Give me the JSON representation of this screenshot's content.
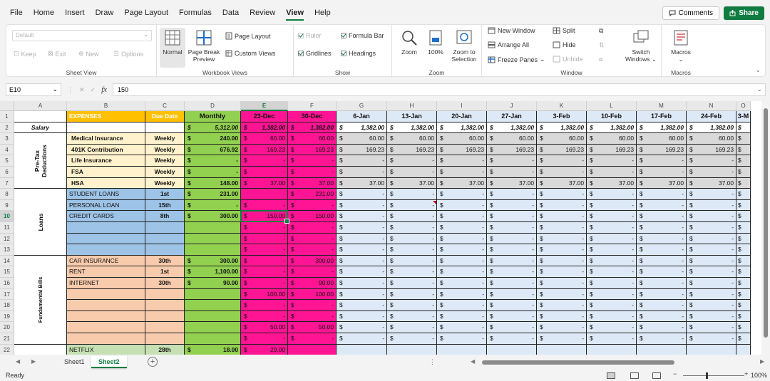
{
  "menu": {
    "items": [
      "File",
      "Home",
      "Insert",
      "Draw",
      "Page Layout",
      "Formulas",
      "Data",
      "Review",
      "View",
      "Help"
    ],
    "active": "View",
    "comments": "Comments",
    "share": "Share"
  },
  "ribbon": {
    "sheet_view": {
      "dropdown": "Default",
      "keep": "Keep",
      "exit": "Exit",
      "new": "New",
      "options": "Options",
      "label": "Sheet View"
    },
    "workbook_views": {
      "normal": "Normal",
      "page_break_1": "Page Break",
      "page_break_2": "Preview",
      "page_layout": "Page Layout",
      "custom_views": "Custom Views",
      "label": "Workbook Views"
    },
    "show": {
      "ruler": "Ruler",
      "formula_bar": "Formula Bar",
      "gridlines": "Gridlines",
      "headings": "Headings",
      "label": "Show"
    },
    "zoom": {
      "zoom": "Zoom",
      "hundred": "100%",
      "zoom_sel_1": "Zoom to",
      "zoom_sel_2": "Selection",
      "label": "Zoom"
    },
    "window": {
      "new_window": "New Window",
      "arrange_all": "Arrange All",
      "freeze_panes": "Freeze Panes",
      "split": "Split",
      "hide": "Hide",
      "unhide": "Unhide",
      "switch_1": "Switch",
      "switch_2": "Windows",
      "label": "Window"
    },
    "macros": {
      "macros": "Macros",
      "label": "Macros"
    }
  },
  "formula_bar": {
    "name_box": "E10",
    "fx": "fx",
    "value": "150"
  },
  "columns": [
    "A",
    "B",
    "C",
    "D",
    "E",
    "F",
    "G",
    "H",
    "I",
    "J",
    "K",
    "L",
    "M",
    "N",
    "O"
  ],
  "rows": [
    "1",
    "2",
    "3",
    "4",
    "5",
    "6",
    "7",
    "8",
    "9",
    "10",
    "11",
    "12",
    "13",
    "14",
    "15",
    "16",
    "17",
    "18",
    "19",
    "20",
    "21",
    "22"
  ],
  "group_labels": {
    "salary": "Salary",
    "pretax_1": "Pre-Tax",
    "pretax_2": "Deductions",
    "loans": "Loans",
    "fundamental": "Fundamental Bills"
  },
  "headers": {
    "expenses": "EXPENSES",
    "due_date": "Due Date",
    "monthly": "Monthly",
    "dates": [
      "23-Dec",
      "30-Dec",
      "6-Jan",
      "13-Jan",
      "20-Jan",
      "27-Jan",
      "3-Feb",
      "10-Feb",
      "17-Feb",
      "24-Feb",
      "3-M"
    ]
  },
  "dash": "-",
  "dollar": "$",
  "expense_rows": [
    {
      "name": "",
      "due": "",
      "monthly": "5,312.00",
      "weekly": [
        "1,382.00",
        "1,382.00",
        "1,382.00",
        "1,382.00",
        "1,382.00",
        "1,382.00",
        "1,382.00",
        "1,382.00",
        "1,382.00",
        "1,382.00"
      ]
    },
    {
      "name": "Medical Insurance",
      "due": "Weekly",
      "monthly": "240.00",
      "weekly": [
        "60.00",
        "60.00",
        "60.00",
        "60.00",
        "60.00",
        "60.00",
        "60.00",
        "60.00",
        "60.00",
        "60.00"
      ]
    },
    {
      "name": "401K Contribution",
      "due": "Weekly",
      "monthly": "676.92",
      "weekly": [
        "169.23",
        "169.23",
        "169.23",
        "169.23",
        "169.23",
        "169.23",
        "169.23",
        "169.23",
        "169.23",
        "169.23"
      ]
    },
    {
      "name": "Life Insurance",
      "due": "Weekly",
      "monthly": "-",
      "weekly": [
        "-",
        "-",
        "-",
        "-",
        "-",
        "-",
        "-",
        "-",
        "-",
        "-"
      ]
    },
    {
      "name": "FSA",
      "due": "Weekly",
      "monthly": "-",
      "weekly": [
        "-",
        "-",
        "-",
        "-",
        "-",
        "-",
        "-",
        "-",
        "-",
        "-"
      ]
    },
    {
      "name": "HSA",
      "due": "Weekly",
      "monthly": "148.00",
      "weekly": [
        "37.00",
        "37.00",
        "37.00",
        "37.00",
        "37.00",
        "37.00",
        "37.00",
        "37.00",
        "37.00",
        "37.00"
      ]
    },
    {
      "name": "STUDENT LOANS",
      "due": "1st",
      "monthly": "231.00",
      "weekly": [
        "",
        "231.00",
        "-",
        "-",
        "-",
        "-",
        "-",
        "-",
        "-",
        "-"
      ]
    },
    {
      "name": "PERSONAL LOAN",
      "due": "15th",
      "monthly": "-",
      "weekly": [
        "-",
        "-",
        "-",
        "-",
        "-",
        "-",
        "-",
        "-",
        "-",
        "-"
      ]
    },
    {
      "name": "CREDIT CARDS",
      "due": "8th",
      "monthly": "300.00",
      "weekly": [
        "150.00",
        "150.00",
        "-",
        "-",
        "-",
        "-",
        "-",
        "-",
        "-",
        "-"
      ]
    },
    {
      "name": "",
      "due": "",
      "monthly": "",
      "weekly": [
        "-",
        "-",
        "-",
        "-",
        "-",
        "-",
        "-",
        "-",
        "-",
        "-"
      ]
    },
    {
      "name": "",
      "due": "",
      "monthly": "",
      "weekly": [
        "-",
        "-",
        "-",
        "-",
        "-",
        "-",
        "-",
        "-",
        "-",
        "-"
      ]
    },
    {
      "name": "",
      "due": "",
      "monthly": "",
      "weekly": [
        "-",
        "-",
        "-",
        "-",
        "-",
        "-",
        "-",
        "-",
        "-",
        "-"
      ]
    },
    {
      "name": "CAR INSURANCE",
      "due": "30th",
      "monthly": "300.00",
      "weekly": [
        "-",
        "300.00",
        "-",
        "-",
        "-",
        "-",
        "-",
        "-",
        "-",
        "-"
      ]
    },
    {
      "name": "RENT",
      "due": "1st",
      "monthly": "1,100.00",
      "weekly": [
        "-",
        "-",
        "-",
        "-",
        "-",
        "-",
        "-",
        "-",
        "-",
        "-"
      ]
    },
    {
      "name": "INTERNET",
      "due": "30th",
      "monthly": "90.00",
      "weekly": [
        "-",
        "90.00",
        "-",
        "-",
        "-",
        "-",
        "-",
        "-",
        "-",
        "-"
      ]
    },
    {
      "name": "",
      "due": "",
      "monthly": "",
      "weekly": [
        "100.00",
        "100.00",
        "-",
        "-",
        "-",
        "-",
        "-",
        "-",
        "-",
        "-"
      ]
    },
    {
      "name": "",
      "due": "",
      "monthly": "",
      "weekly": [
        "-",
        "-",
        "-",
        "-",
        "-",
        "-",
        "-",
        "-",
        "-",
        "-"
      ]
    },
    {
      "name": "",
      "due": "",
      "monthly": "",
      "weekly": [
        "-",
        "-",
        "-",
        "-",
        "-",
        "-",
        "-",
        "-",
        "-",
        "-"
      ]
    },
    {
      "name": "",
      "due": "",
      "monthly": "",
      "weekly": [
        "50.00",
        "50.00",
        "-",
        "-",
        "-",
        "-",
        "-",
        "-",
        "-",
        "-"
      ]
    },
    {
      "name": "",
      "due": "",
      "monthly": "",
      "weekly": [
        "-",
        "-",
        "-",
        "-",
        "-",
        "-",
        "-",
        "-",
        "-",
        "-"
      ]
    },
    {
      "name": "NETFLIX",
      "due": "28th",
      "monthly": "18.00",
      "weekly": [
        "29.00",
        "",
        "",
        "",
        "",
        "",
        "",
        "",
        "",
        ""
      ]
    }
  ],
  "tabs": {
    "sheets": [
      "Sheet1",
      "Sheet2"
    ],
    "active": "Sheet2"
  },
  "status": {
    "ready": "Ready",
    "zoom": "100%"
  },
  "colors": {
    "accent": "#107c41",
    "expenses_header": "#ffc000",
    "monthly": "#92d050",
    "pink": "#ff1493",
    "light_blue": "#dde9f7",
    "pale_yellow": "#fff2cc",
    "loans_blue": "#9dc3e6",
    "bills_orange": "#f8cbad",
    "gray_row": "#d9d9d9",
    "netflix_green": "#c6e0b4"
  },
  "icons": [
    "comment-icon",
    "share-icon",
    "normal-view-icon",
    "page-break-icon",
    "page-layout-icon",
    "custom-views-icon",
    "zoom-icon",
    "zoom-100-icon",
    "zoom-selection-icon",
    "new-window-icon",
    "arrange-all-icon",
    "freeze-panes-icon",
    "split-icon",
    "hide-icon",
    "unhide-icon",
    "switch-windows-icon",
    "macros-icon",
    "fx-icon"
  ]
}
